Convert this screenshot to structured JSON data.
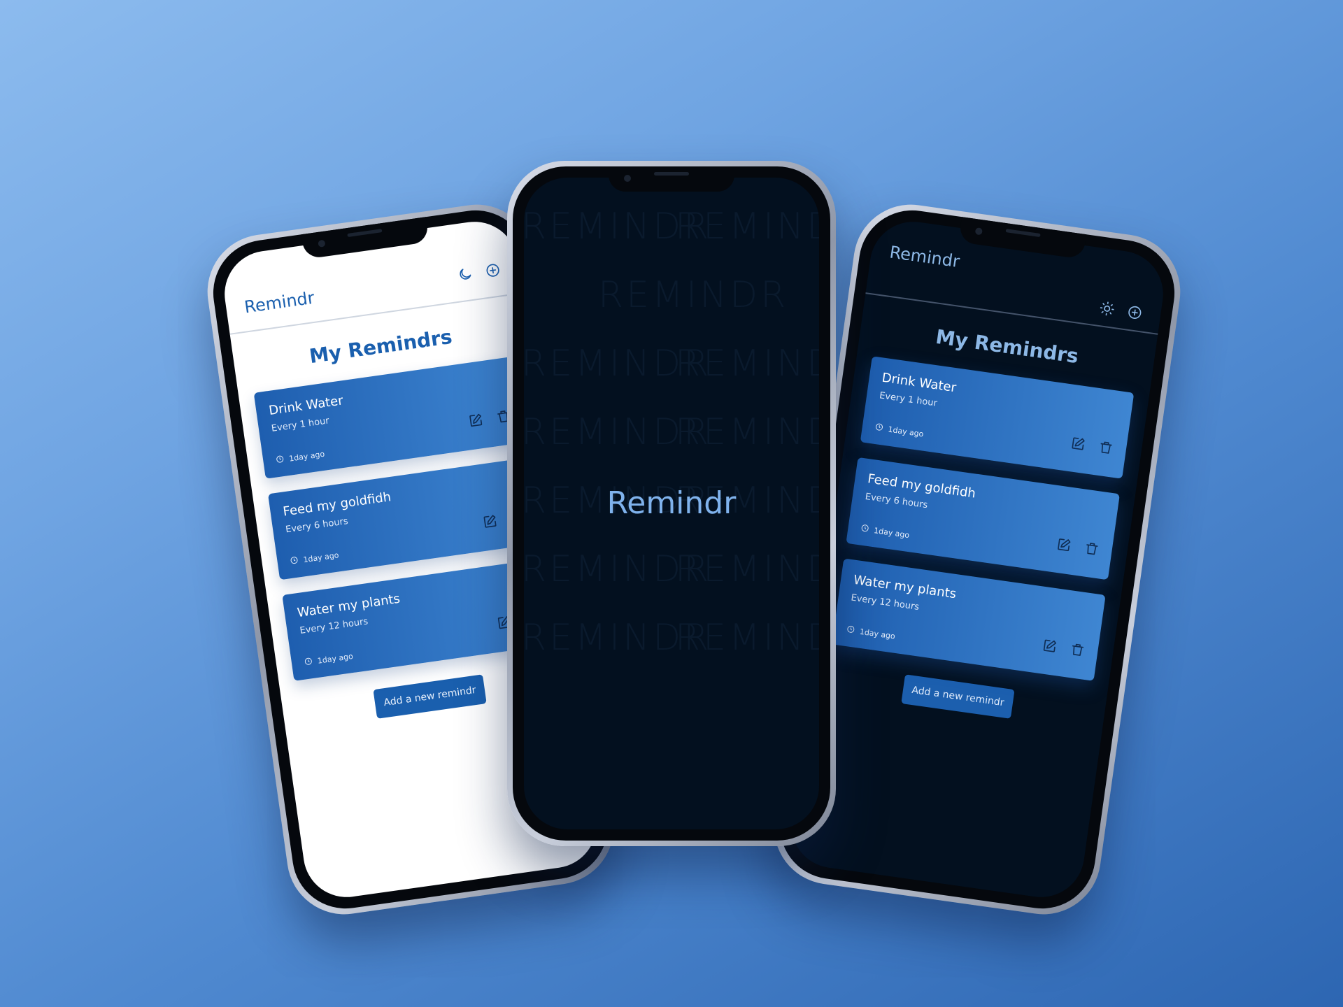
{
  "app": {
    "brand": "Remindr",
    "page_title": "My Remindrs",
    "add_button_label": "Add a new remindr"
  },
  "splash": {
    "title": "Remindr",
    "watermark_text": "REMINDR"
  },
  "reminders": [
    {
      "title": "Drink Water",
      "frequency": "Every 1 hour",
      "created": "1day ago"
    },
    {
      "title": "Feed my goldfidh",
      "frequency": "Every 6 hours",
      "created": "1day ago"
    },
    {
      "title": "Water my plants",
      "frequency": "Every 12 hours",
      "created": "1day ago"
    }
  ],
  "icons": {
    "theme_toggle_light_mode": "moon-icon",
    "theme_toggle_dark_mode": "sun-icon",
    "add": "plus-circle-icon",
    "edit": "edit-icon",
    "delete": "trash-icon",
    "time": "clock-icon"
  },
  "colors": {
    "background_gradient_start": "#8cbbee",
    "background_gradient_end": "#2d66b2",
    "accent": "#1a5fae",
    "card_gradient_start": "#1e5eaf",
    "card_gradient_end": "#3f86d2",
    "dark_surface": "#03101f",
    "dark_accent_text": "#8db8e6",
    "splash_title": "#7fb2ec"
  }
}
